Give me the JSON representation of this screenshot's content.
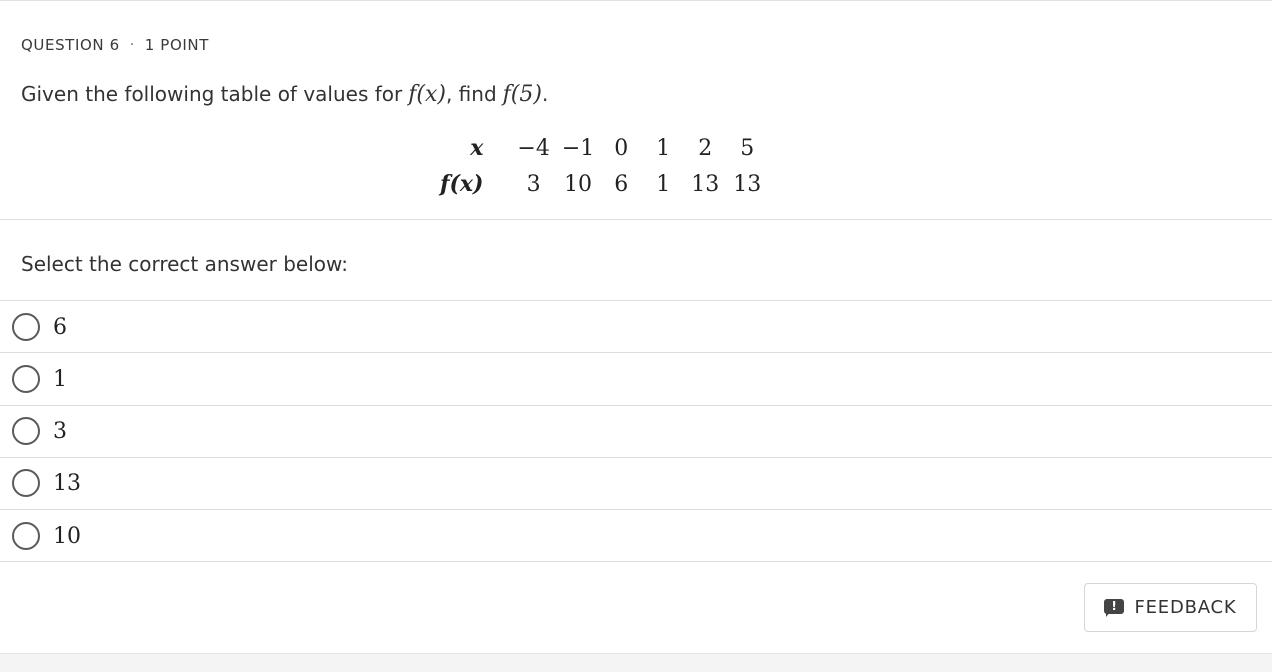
{
  "question": {
    "number_label": "QUESTION 6",
    "separator": "·",
    "points_label": "1 POINT",
    "prompt_prefix": "Given the following table of values for",
    "prompt_func": "f(x)",
    "prompt_mid": ", find",
    "prompt_target": "f(5)",
    "prompt_suffix": "."
  },
  "table": {
    "row_headers": [
      "x",
      "f(x)"
    ],
    "x_values": [
      "−4",
      "−1",
      "0",
      "1",
      "2",
      "5"
    ],
    "fx_values": [
      "3",
      "10",
      "6",
      "1",
      "13",
      "13"
    ]
  },
  "instruction": "Select the correct answer below:",
  "options": [
    {
      "label": "6"
    },
    {
      "label": "1"
    },
    {
      "label": "3"
    },
    {
      "label": "13"
    },
    {
      "label": "10"
    }
  ],
  "feedback": {
    "label": "FEEDBACK",
    "icon": "feedback-icon"
  },
  "colors": {
    "text": "#333333",
    "rule": "#dedede",
    "radio_border": "#5a5a5a"
  }
}
